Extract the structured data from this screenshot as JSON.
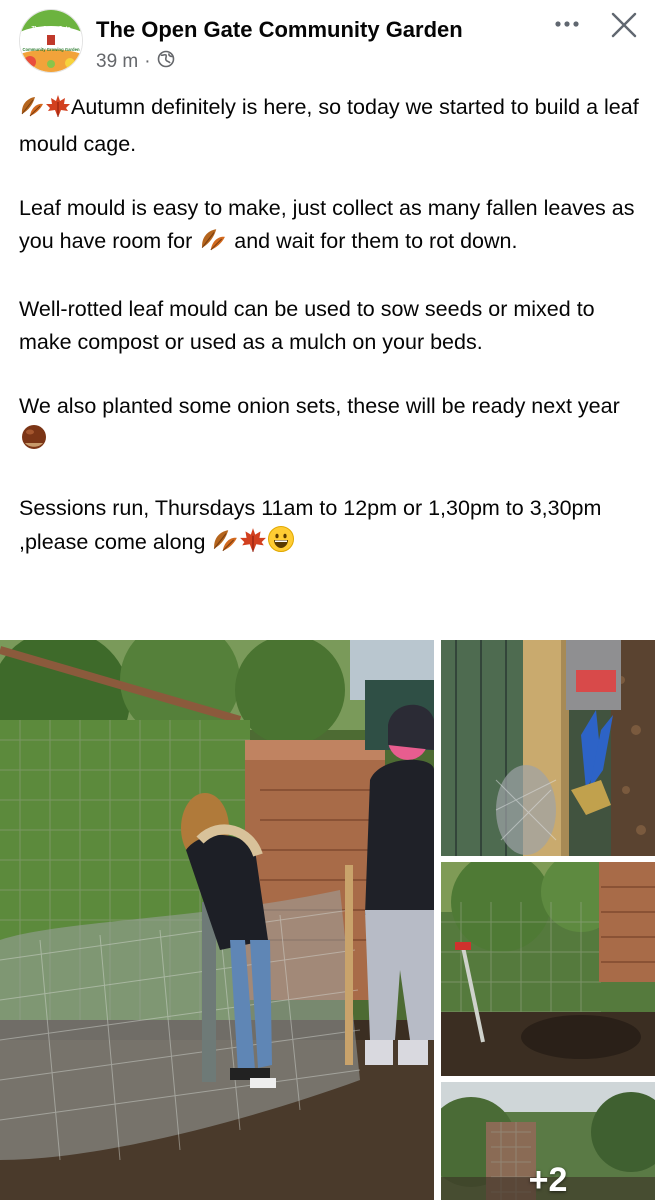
{
  "post": {
    "author": "The Open Gate Community Garden",
    "avatar_text": [
      "The Open Gate",
      "Community Growing Garden"
    ],
    "time": "39 m",
    "separator": "·",
    "privacy_icon": "globe-icon",
    "paragraphs": [
      {
        "pre": "",
        "text": "Autumn definitely is here, so today we started to build a leaf mould cage.",
        "leading_emojis": [
          "fallen-leaf-emoji",
          "maple-leaf-emoji"
        ]
      },
      {
        "a": "Leaf mould is easy to make, just collect as many fallen leaves as you have room for ",
        "b": " and wait for them to rot down.",
        "emoji": "fallen-leaf-emoji"
      },
      {
        "text": "Well-rotted leaf mould can be used to sow seeds or mixed to make compost or used as a mulch on your beds."
      },
      {
        "text": "We also planted some onion sets, these will be ready next year ",
        "emoji": "chestnut-emoji"
      },
      {
        "text": "Sessions run, Thursdays 11am to 12pm or 1,30pm to 3,30pm ,please come along ",
        "emojis": [
          "fallen-leaf-emoji",
          "maple-leaf-emoji",
          "grinning-face-emoji"
        ]
      }
    ]
  },
  "photos": {
    "extra_count": "+2"
  },
  "colors": {
    "text": "#050505",
    "secondary": "#65676b"
  }
}
